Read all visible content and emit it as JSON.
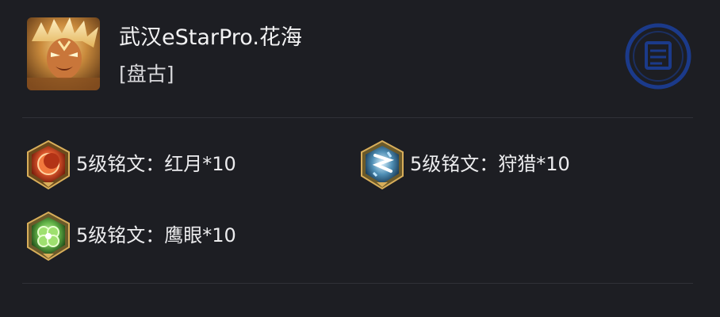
{
  "player": {
    "name": "武汉eStarPro.花海",
    "hero": "[盘古]"
  },
  "runes": [
    {
      "label": "5级铭文：红月*10",
      "icon": "red-moon-rune-icon",
      "color": "#d9542b"
    },
    {
      "label": "5级铭文：狩猎*10",
      "icon": "hunt-rune-icon",
      "color": "#4f8fb5"
    },
    {
      "label": "5级铭文：鹰眼*10",
      "icon": "hawk-eye-rune-icon",
      "color": "#67b94b"
    }
  ],
  "colors": {
    "background": "#1d1e23",
    "divider": "#303138",
    "text": "#ececee",
    "stamp": "#1b3a8a"
  }
}
